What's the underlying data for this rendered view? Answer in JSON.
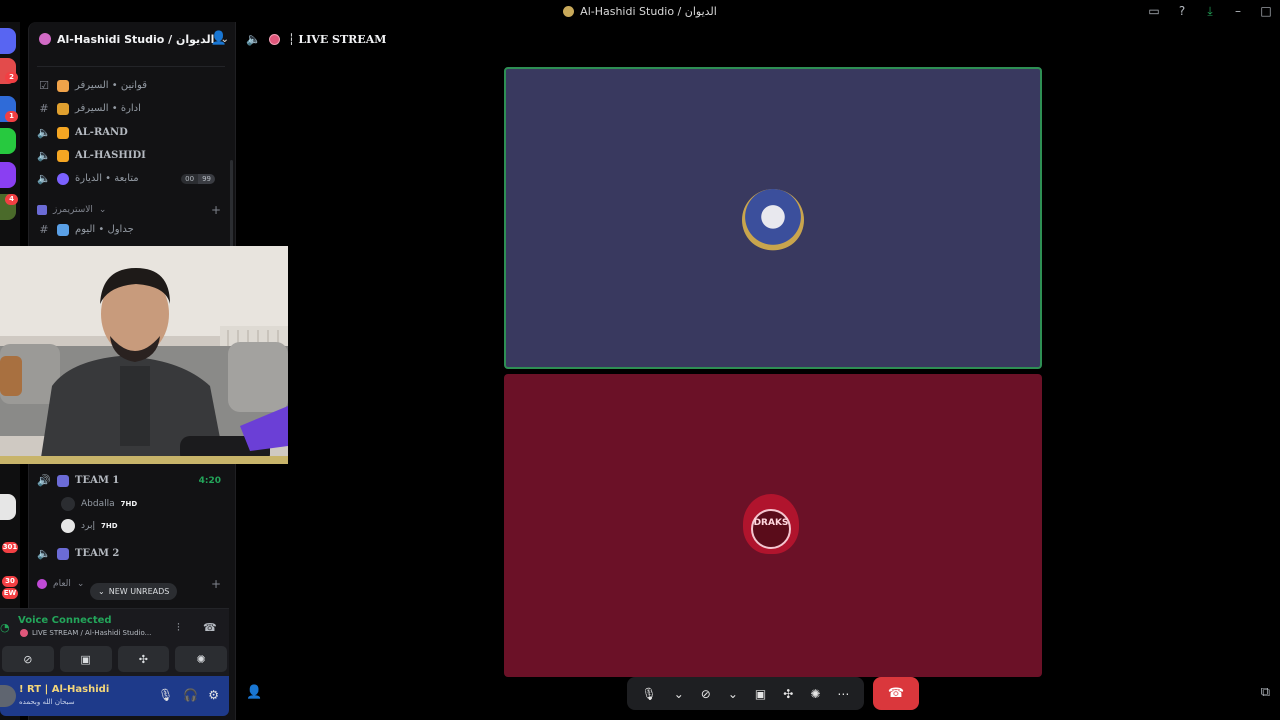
{
  "window": {
    "title": "Al-Hashidi Studio / الديوان",
    "controls": [
      "inbox-icon",
      "help-icon",
      "download-icon",
      "minimize-icon",
      "maximize-icon"
    ]
  },
  "server": {
    "name": "Al-Hashidi Studio / الديوان",
    "channels": [
      {
        "type": "rules",
        "emoji_color": "#f0a34a",
        "name": "قوانين • السيرفر",
        "bold": false
      },
      {
        "type": "text",
        "emoji_color": "#e0a02f",
        "name": "ادارة • السيرفر",
        "bold": false
      },
      {
        "type": "voice",
        "emoji_color": "#f5a623",
        "name": "AL-RAND",
        "bold": true
      },
      {
        "type": "voice",
        "emoji_color": "#f5a623",
        "name": "AL-HASHIDI",
        "bold": true
      },
      {
        "type": "voice",
        "emoji_color": "#7b61ff",
        "name": "متابعة • الديارة",
        "bold": false,
        "counts": [
          "00",
          "99"
        ]
      }
    ],
    "category_streamers": "الاستريمرز",
    "channel_schedule": "جداول • اليوم",
    "voice_channels": [
      {
        "name": "TEAM 1",
        "time": "4:20",
        "members": [
          {
            "name": "Abdalla",
            "tag": "7HD"
          },
          {
            "name": "إبرد",
            "tag": "7HD"
          }
        ]
      },
      {
        "name": "TEAM 2",
        "time": "",
        "members": []
      }
    ],
    "category_general": "العام",
    "new_unreads": "NEW UNREADS",
    "server_badges": [
      "2",
      "1",
      "4",
      "301",
      "30",
      "EW"
    ]
  },
  "voice": {
    "status": "Voice Connected",
    "channel": "LIVE STREAM / Al-Hashidi Studio..."
  },
  "user": {
    "name": "! RT | Al-Hashidi",
    "status": "سبحان الله وبحمده"
  },
  "topbar": {
    "channel": "┆ LIVE STREAM"
  },
  "tiles": [
    {
      "color": "#39395f",
      "speaking": true
    },
    {
      "color": "#6b1127",
      "speaking": false,
      "label": "DRAKS"
    }
  ],
  "colors": {
    "accent_green": "#23a55a",
    "hangup_red": "#da373c",
    "user_panel": "#1e3a8a"
  }
}
